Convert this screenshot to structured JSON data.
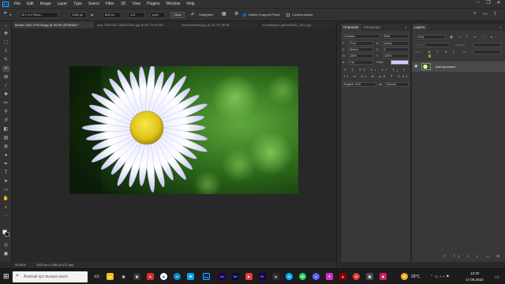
{
  "menubar": {
    "logo": "Ps",
    "items": [
      "File",
      "Edit",
      "Image",
      "Layer",
      "Type",
      "Select",
      "Filter",
      "3D",
      "View",
      "Plugins",
      "Window",
      "Help"
    ]
  },
  "options": {
    "ratio": "W x H x Reso...",
    "px1": "1280 px",
    "px2": "800 px",
    "res": "113",
    "res_unit": "px/in",
    "clear": "Clear",
    "straighten": "Straighten",
    "delete_cropped": "Delete Cropped Pixels",
    "content_aware": "Content-Aware"
  },
  "tabs": [
    {
      "label": "thumb-1920-479126.jpg @ 45,5% (RGB/8#) *"
    },
    {
      "label": "pxsl-1509763-1456592048.jpg @ 66,7% (RGB/..."
    },
    {
      "label": "maxresdefault.jpg @ 16,7% (RGB..."
    },
    {
      "label": "hd-wallpaper-glfwbd2c56_1920.jpg"
    }
  ],
  "status": {
    "zoom": "45,45%",
    "size": "1920 px x 1080 px (72 ppi)"
  },
  "character": {
    "tabs": [
      "Character",
      "Paragraph"
    ],
    "font_family": "Candara",
    "font_style": "Bold",
    "size": "75 pt",
    "leading": "(Auto)",
    "kerning": "Metrics",
    "tracking": "0",
    "vscale": "100%",
    "hscale": "100%",
    "baseline": "0 pt",
    "color_label": "Color:",
    "language": "English: USA",
    "antialias": "Smooth"
  },
  "layers": {
    "tab": "Layers",
    "search_placeholder": "Kind",
    "blend": "Normal",
    "opacity_label": "Opacity:",
    "fill_label": "Fill:",
    "layer_name": "Arai Aprosanil",
    "lock_label": "Lock:"
  },
  "taskbar": {
    "search_placeholder": "Aramak için buraya yazın",
    "temperature": "29°C",
    "time": "12:30",
    "date": "17.09.2022"
  },
  "colors": {
    "ps_blue": "#31a8ff",
    "accent": "#0a64c8"
  }
}
